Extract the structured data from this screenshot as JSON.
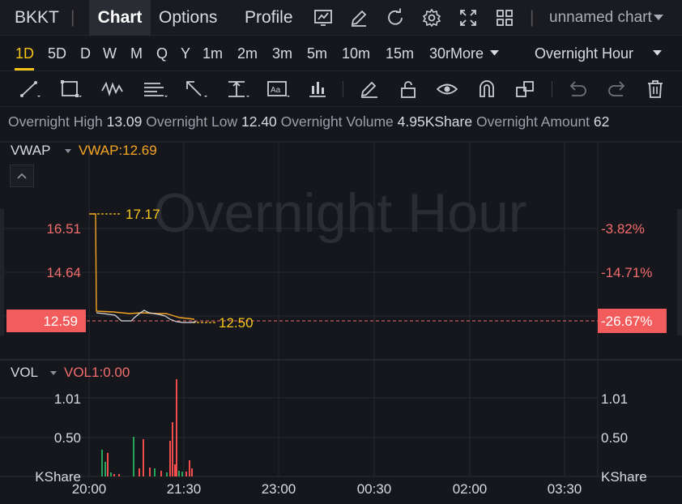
{
  "nav": {
    "symbol": "BKKT",
    "tabs": [
      "Chart",
      "Options",
      "Profile"
    ],
    "chart_name": "unnamed chart"
  },
  "timeframes": {
    "items": [
      "1D",
      "5D",
      "D",
      "W",
      "M",
      "Q",
      "Y",
      "1m",
      "2m",
      "3m",
      "5m",
      "10m",
      "15m",
      "30r"
    ],
    "selected": "1D",
    "more_label": "More",
    "session_label": "Overnight Hour"
  },
  "info_bar": {
    "high_label": "Overnight High",
    "high_value": "13.09",
    "low_label": "Overnight Low",
    "low_value": "12.40",
    "volume_label": "Overnight Volume",
    "volume_value": "4.95KShare",
    "amount_label": "Overnight Amount",
    "amount_value": "62"
  },
  "price_panel": {
    "indicator": "VWAP",
    "indicator_value": "VWAP:12.69",
    "watermark": "Overnight Hour",
    "left_ticks": [
      "16.51",
      "14.64"
    ],
    "right_ticks": [
      "-3.82%",
      "-14.71%"
    ],
    "current_price": "12.59",
    "current_pct": "-26.67%",
    "high_marker": "17.17",
    "low_marker": "12.50"
  },
  "volume_panel": {
    "indicator": "VOL",
    "indicator_value": "VOL1:0.00",
    "ticks": [
      "1.01",
      "0.50"
    ],
    "unit": "KShare"
  },
  "time_axis": [
    "20:00",
    "21:30",
    "23:00",
    "00:30",
    "02:00",
    "03:30"
  ],
  "colors": {
    "up": "#26a65b",
    "down": "#f24d4d",
    "accent": "#f5c518",
    "vwap": "#f5a623",
    "background": "#16171c"
  },
  "icons": [
    "line-tool-icon",
    "rectangle-tool-icon",
    "pattern-tool-icon",
    "fib-tool-icon",
    "arrow-tool-icon",
    "measure-tool-icon",
    "text-tool-icon",
    "indicator-tool-icon",
    "pencil-icon",
    "lock-icon",
    "eye-icon",
    "magnet-icon",
    "layers-icon",
    "undo-icon",
    "redo-icon",
    "trash-icon"
  ]
}
